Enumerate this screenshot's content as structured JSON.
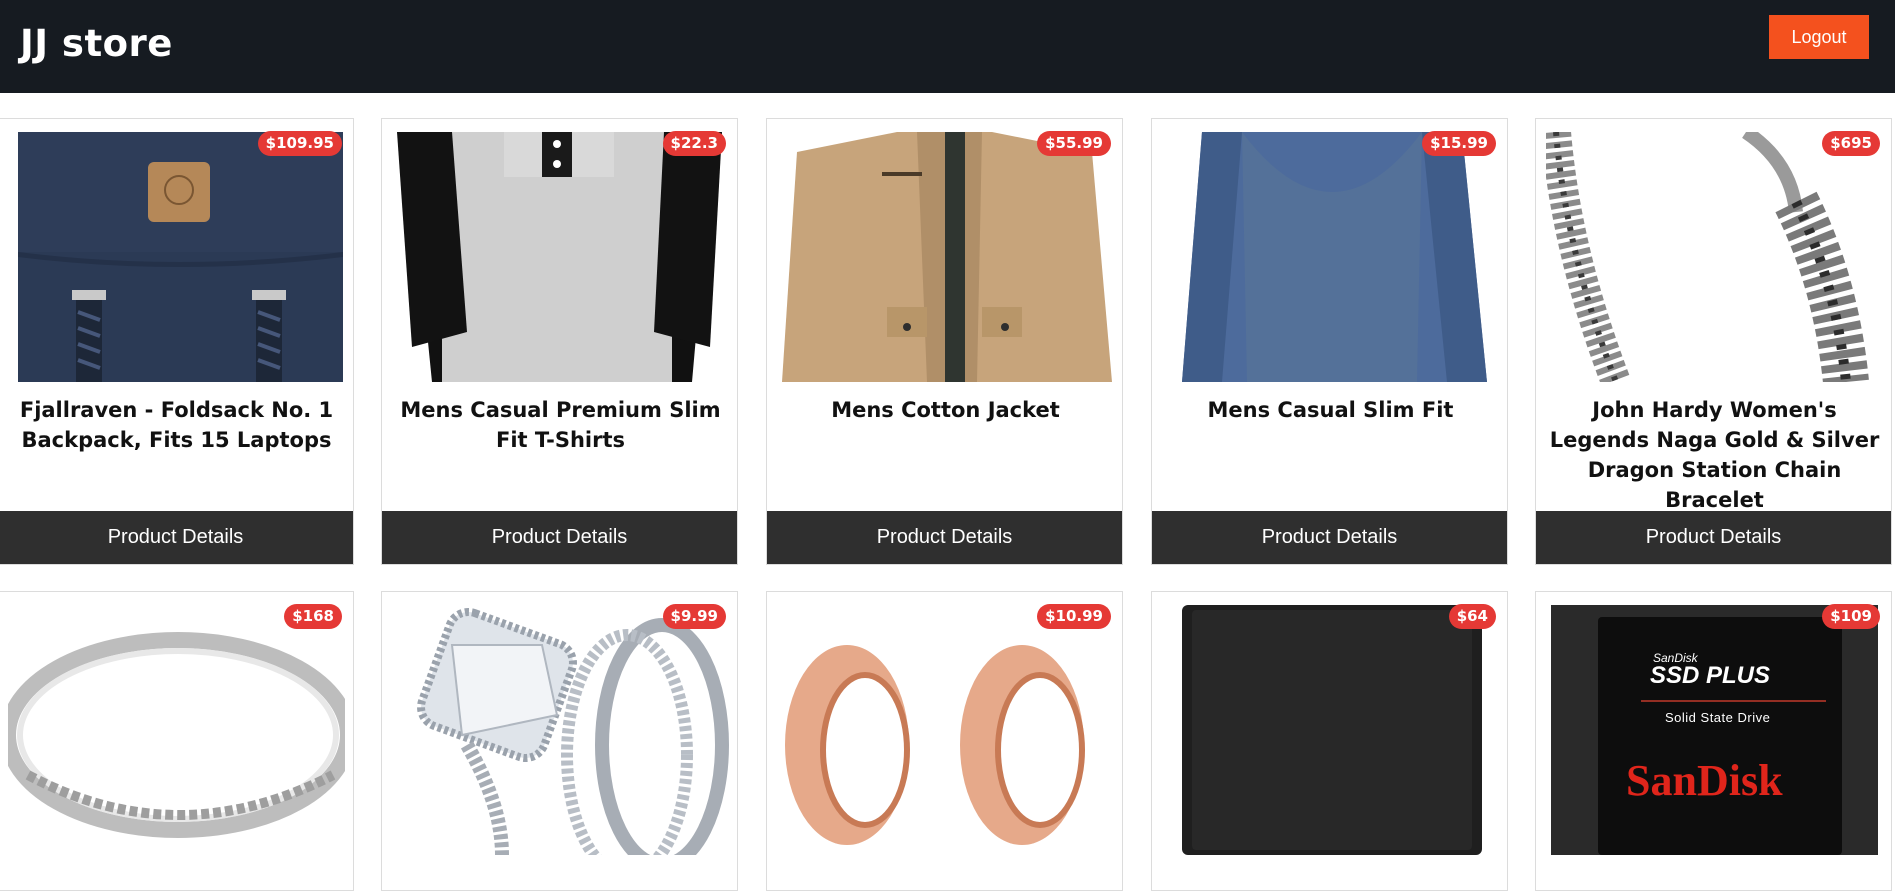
{
  "brand": "JJ store",
  "nav": {
    "logout_label": "Logout"
  },
  "details_label": "Product Details",
  "products": [
    {
      "title": "Fjallraven - Foldsack No. 1 Backpack, Fits 15 Laptops",
      "price": "$109.95",
      "image": "backpack"
    },
    {
      "title": "Mens Casual Premium Slim Fit T-Shirts",
      "price": "$22.3",
      "image": "tshirt"
    },
    {
      "title": "Mens Cotton Jacket",
      "price": "$55.99",
      "image": "jacket"
    },
    {
      "title": "Mens Casual Slim Fit",
      "price": "$15.99",
      "image": "longsleeve"
    },
    {
      "title": "John Hardy Women's Legends Naga Gold & Silver Dragon Station Chain Bracelet",
      "price": "$695",
      "image": "bracelet"
    },
    {
      "title": "",
      "price": "$168",
      "image": "ring-band"
    },
    {
      "title": "",
      "price": "$9.99",
      "image": "ring-diamond"
    },
    {
      "title": "",
      "price": "$10.99",
      "image": "ear-tunnels"
    },
    {
      "title": "",
      "price": "$64",
      "image": "hard-drive"
    },
    {
      "title": "",
      "price": "$109",
      "image": "ssd",
      "ssd_text": {
        "brand_small": "SanDisk",
        "line1": "SSD PLUS",
        "line2": "Solid State Drive",
        "logo": "SanDisk"
      }
    }
  ],
  "colors": {
    "navbar": "#161b21",
    "logout": "#f4511e",
    "price_badge": "#e53935",
    "details_button": "#2f2f2f"
  }
}
